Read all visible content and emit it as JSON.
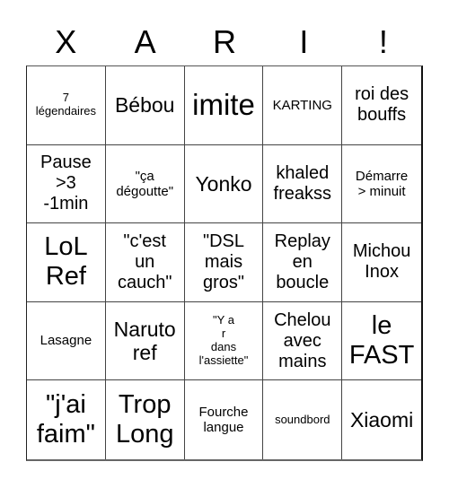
{
  "title_letters": [
    "X",
    "A",
    "R",
    "I",
    "!"
  ],
  "cells": [
    {
      "text": "7\nlégendaires",
      "size": "xs"
    },
    {
      "text": "Bébou",
      "size": "l"
    },
    {
      "text": "imite",
      "size": "xxl"
    },
    {
      "text": "KARTING",
      "size": "s"
    },
    {
      "text": "roi des\nbouffs",
      "size": "m"
    },
    {
      "text": "Pause\n>3\n-1min",
      "size": "m"
    },
    {
      "text": "\"ça\ndégoutte\"",
      "size": "s"
    },
    {
      "text": "Yonko",
      "size": "l"
    },
    {
      "text": "khaled\nfreakss",
      "size": "m"
    },
    {
      "text": "Démarre\n> minuit",
      "size": "s"
    },
    {
      "text": "LoL\nRef",
      "size": "xl"
    },
    {
      "text": "\"c'est\nun\ncauch\"",
      "size": "m"
    },
    {
      "text": "\"DSL\nmais\ngros\"",
      "size": "m"
    },
    {
      "text": "Replay\nen\nboucle",
      "size": "m"
    },
    {
      "text": "Michou\nInox",
      "size": "m"
    },
    {
      "text": "Lasagne",
      "size": "s"
    },
    {
      "text": "Naruto\nref",
      "size": "l"
    },
    {
      "text": "\"Y a\nr\ndans\nl'assiette\"",
      "size": "xs"
    },
    {
      "text": "Chelou\navec\nmains",
      "size": "m"
    },
    {
      "text": "le\nFAST",
      "size": "xl"
    },
    {
      "text": "\"j'ai\nfaim\"",
      "size": "xl"
    },
    {
      "text": "Trop\nLong",
      "size": "xl"
    },
    {
      "text": "Fourche\nlangue",
      "size": "s"
    },
    {
      "text": "soundbord",
      "size": "xs"
    },
    {
      "text": "Xiaomi",
      "size": "l"
    }
  ]
}
